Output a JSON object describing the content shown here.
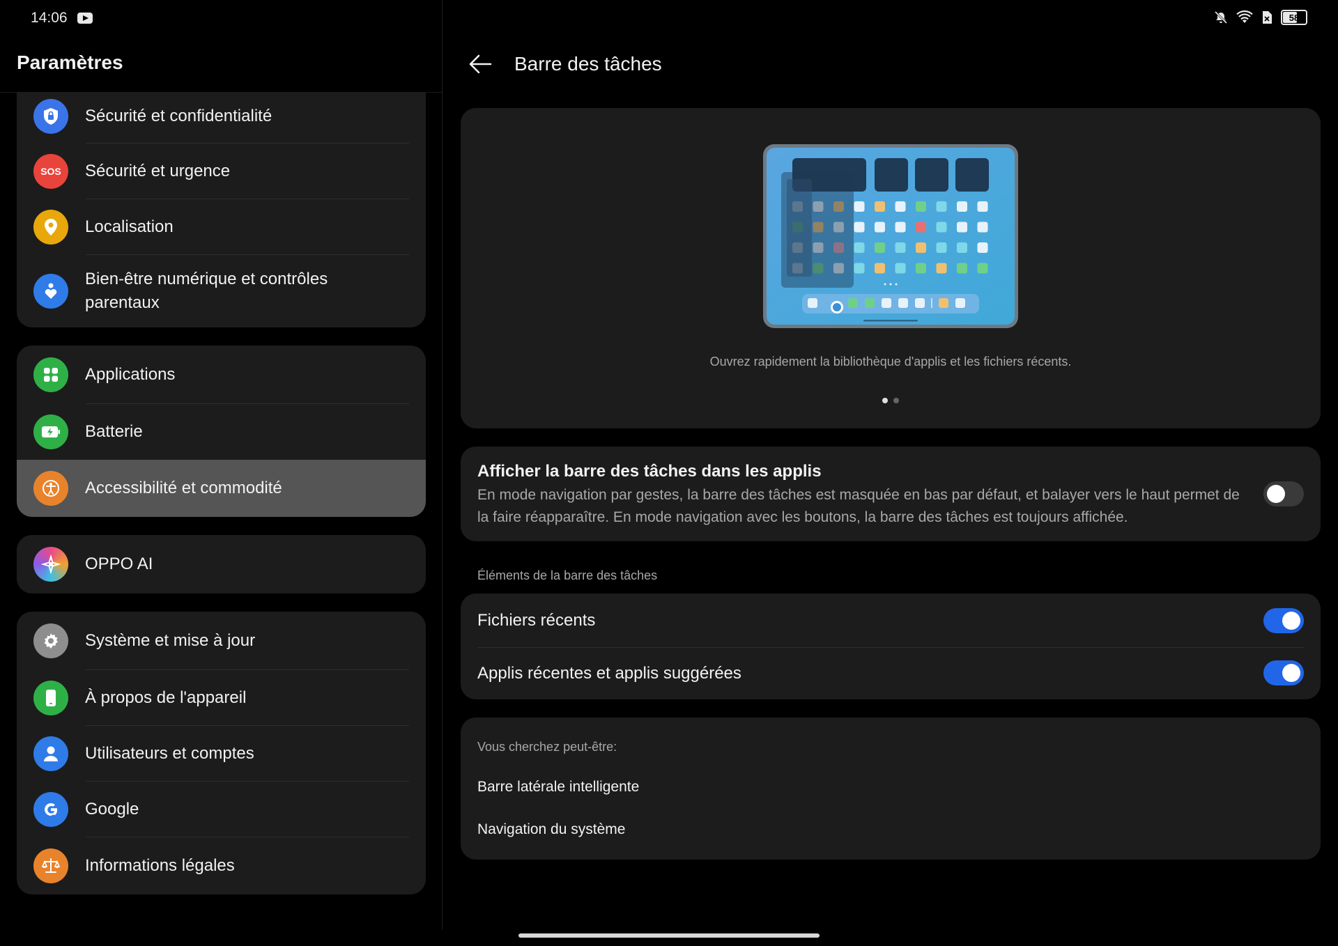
{
  "status_bar": {
    "time": "14:06",
    "battery": "58",
    "icons": [
      "youtube-icon",
      "mute-icon",
      "wifi-icon",
      "sim-icon",
      "battery-icon"
    ]
  },
  "left_panel": {
    "title": "Paramètres",
    "groups": [
      [
        {
          "label": "Sécurité et confidentialité",
          "icon": "shield-lock-icon",
          "color": "#3b74e8"
        },
        {
          "label": "Sécurité et urgence",
          "icon": "sos-icon",
          "icon_text": "SOS",
          "color": "#e8443b"
        },
        {
          "label": "Localisation",
          "icon": "location-pin-icon",
          "color": "#e8a70b"
        },
        {
          "label": "Bien-être numérique et contrôles parentaux",
          "icon": "heart-person-icon",
          "color": "#2f7be8"
        }
      ],
      [
        {
          "label": "Applications",
          "icon": "apps-grid-icon",
          "color": "#2fb047"
        },
        {
          "label": "Batterie",
          "icon": "battery-charging-icon",
          "color": "#2fb047"
        },
        {
          "label": "Accessibilité et commodité",
          "icon": "accessibility-icon",
          "color": "#e8832b",
          "selected": true
        }
      ],
      [
        {
          "label": "OPPO AI",
          "icon": "oppo-ai-icon",
          "color": "#c04de0"
        }
      ],
      [
        {
          "label": "Système et mise à jour",
          "icon": "gear-icon",
          "color": "#8e8e8e"
        },
        {
          "label": "À propos de l'appareil",
          "icon": "phone-icon",
          "color": "#2fb047"
        },
        {
          "label": "Utilisateurs et comptes",
          "icon": "user-icon",
          "color": "#2f7be8"
        },
        {
          "label": "Google",
          "icon": "google-icon",
          "color": "#2f7be8"
        },
        {
          "label": "Informations légales",
          "icon": "scales-icon",
          "color": "#e8832b"
        }
      ]
    ]
  },
  "right_panel": {
    "title": "Barre des tâches",
    "hero": {
      "caption": "Ouvrez rapidement la bibliothèque d'applis et les fichiers récents.",
      "page_count": 2,
      "active_page": 1
    },
    "show_taskbar": {
      "title": "Afficher la barre des tâches dans les applis",
      "description": "En mode navigation par gestes, la barre des tâches est masquée en bas par défaut, et balayer vers le haut permet de la faire réapparaître. En mode navigation avec les boutons, la barre des tâches est toujours affichée.",
      "enabled": false
    },
    "elements_section": {
      "label": "Éléments de la barre des tâches",
      "items": [
        {
          "label": "Fichiers récents",
          "enabled": true
        },
        {
          "label": "Applis récentes et applis suggérées",
          "enabled": true
        }
      ]
    },
    "suggestions": {
      "label": "Vous cherchez peut-être:",
      "items": [
        "Barre latérale intelligente",
        "Navigation du système"
      ]
    }
  },
  "colors": {
    "accent": "#2166e8",
    "card_bg": "#1c1c1c",
    "selected_bg": "#555555"
  }
}
